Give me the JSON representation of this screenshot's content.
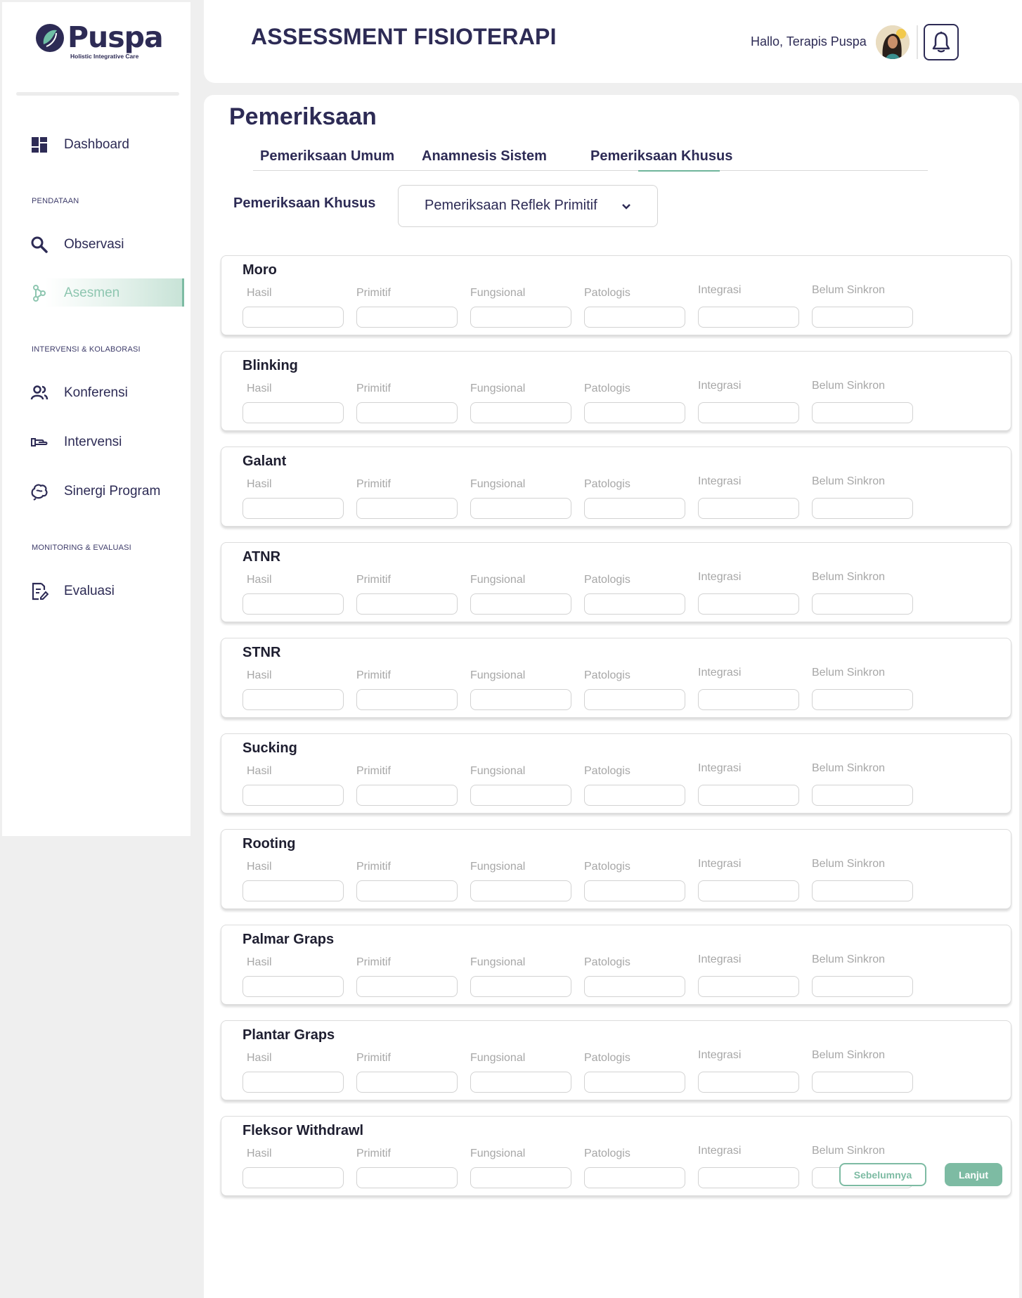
{
  "app": {
    "brand": "Puspa",
    "tagline": "Holistic Integrative Care"
  },
  "sidebar": {
    "dashboard": {
      "label": "Dashboard",
      "icon": "dashboard-icon"
    },
    "sections": {
      "pendataan": "PENDATAAN",
      "intervensi": "INTERVENSI & KOLABORASI",
      "monitoring": "MONITORING & EVALUASI"
    },
    "items": [
      {
        "label": "Observasi",
        "icon": "search-icon"
      },
      {
        "label": "Asesmen",
        "icon": "molecule-icon",
        "active": true
      },
      {
        "label": "Konferensi",
        "icon": "users-icon"
      },
      {
        "label": "Intervensi",
        "icon": "hand-icon"
      },
      {
        "label": "Sinergi Program",
        "icon": "brain-icon"
      },
      {
        "label": "Evaluasi",
        "icon": "document-edit-icon"
      }
    ]
  },
  "header": {
    "title": "ASSESSMENT FISIOTERAPI",
    "greeting": "Hallo, Terapis Puspa"
  },
  "main": {
    "section_title": "Pemeriksaan",
    "tabs": [
      {
        "label": "Pemeriksaan Umum"
      },
      {
        "label": "Anamnesis Sistem"
      },
      {
        "label": "Pemeriksaan Khusus",
        "active": true
      }
    ],
    "filter_label": "Pemeriksaan Khusus",
    "filter_value": "Pemeriksaan Reflek Primitif",
    "field_labels": [
      "Hasil",
      "Primitif",
      "Fungsional",
      "Patologis",
      "Integrasi",
      "Belum Sinkron"
    ],
    "reflexes": [
      "Moro",
      "Blinking",
      "Galant",
      "ATNR",
      "STNR",
      "Sucking",
      "Rooting",
      "Palmar Graps",
      "Plantar Graps",
      "Fleksor Withdrawl"
    ]
  },
  "buttons": {
    "prev": "Sebelumnya",
    "next": "Lanjut"
  },
  "colors": {
    "primary": "#2d2b55",
    "accent": "#7dbba3",
    "muted_label": "#a7a7a7"
  }
}
